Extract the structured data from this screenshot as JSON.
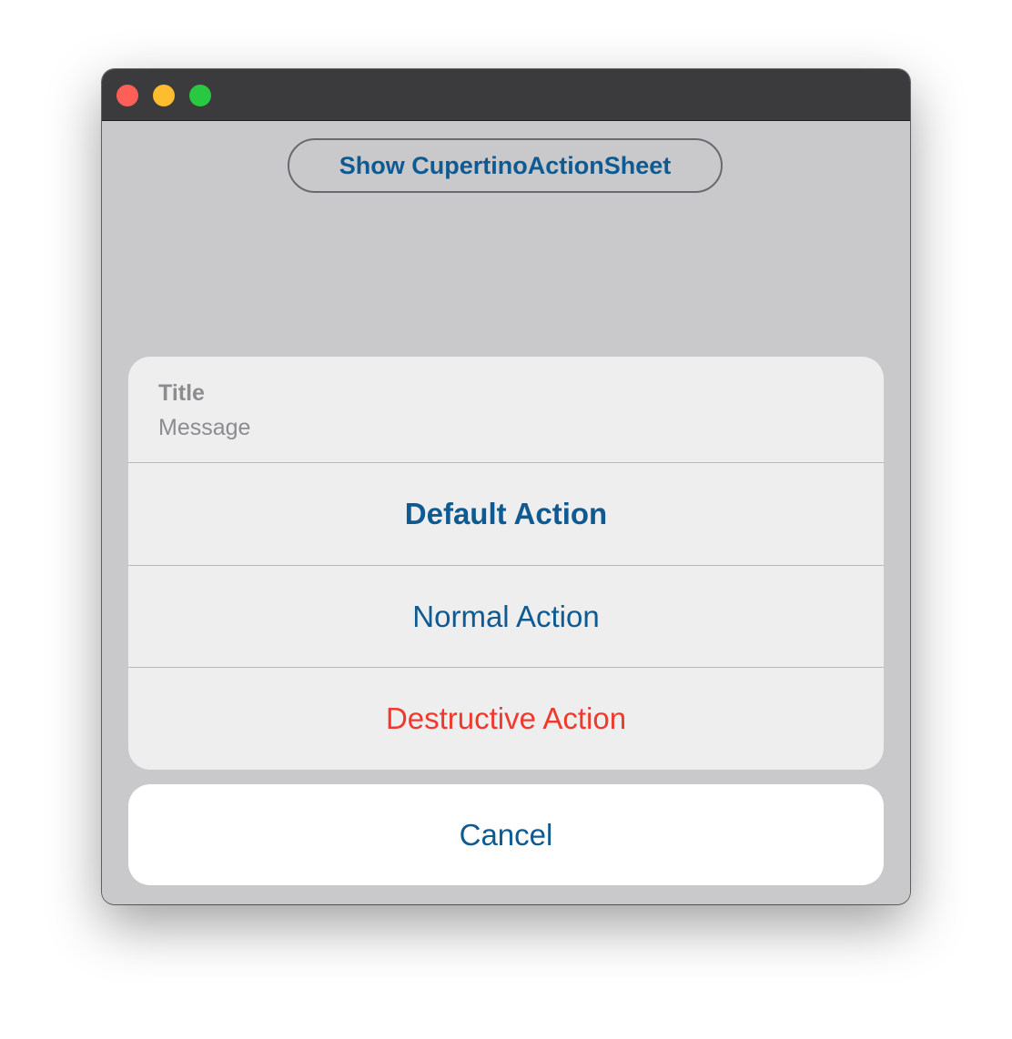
{
  "window": {
    "traffic_lights": {
      "close_color": "#fe5f57",
      "minimize_color": "#febc2e",
      "maximize_color": "#28c840"
    }
  },
  "main": {
    "show_button_label": "Show CupertinoActionSheet"
  },
  "action_sheet": {
    "title": "Title",
    "message": "Message",
    "actions": [
      {
        "label": "Default Action",
        "style": "default"
      },
      {
        "label": "Normal Action",
        "style": "normal"
      },
      {
        "label": "Destructive Action",
        "style": "destructive"
      }
    ],
    "cancel_label": "Cancel"
  },
  "colors": {
    "accent": "#0e5a91",
    "destructive": "#f0392d",
    "secondary_text": "#8c8c8f"
  }
}
